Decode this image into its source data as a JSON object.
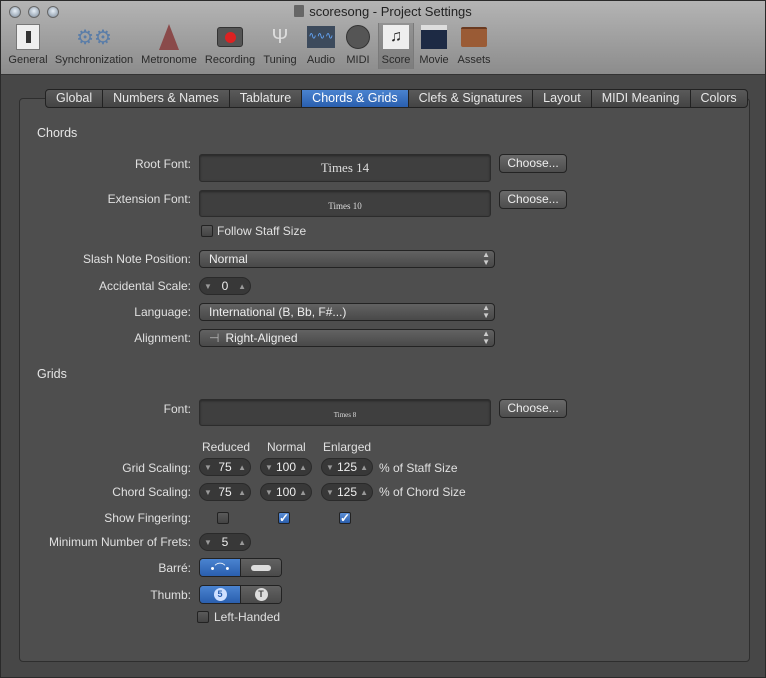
{
  "window": {
    "title": "scoresong - Project Settings"
  },
  "toolbar": [
    {
      "label": "General",
      "icon": "switch-icon"
    },
    {
      "label": "Synchronization",
      "icon": "gears-icon"
    },
    {
      "label": "Metronome",
      "icon": "metronome-icon"
    },
    {
      "label": "Recording",
      "icon": "record-icon"
    },
    {
      "label": "Tuning",
      "icon": "tuning-fork-icon"
    },
    {
      "label": "Audio",
      "icon": "waveform-icon"
    },
    {
      "label": "MIDI",
      "icon": "midi-port-icon"
    },
    {
      "label": "Score",
      "icon": "music-note-icon",
      "selected": true
    },
    {
      "label": "Movie",
      "icon": "clapperboard-icon"
    },
    {
      "label": "Assets",
      "icon": "briefcase-icon"
    }
  ],
  "tabs": [
    "Global",
    "Numbers & Names",
    "Tablature",
    "Chords & Grids",
    "Clefs & Signatures",
    "Layout",
    "MIDI Meaning",
    "Colors"
  ],
  "active_tab": "Chords & Grids",
  "chords": {
    "heading": "Chords",
    "root_font_label": "Root Font:",
    "root_font": "Times 14",
    "extension_font_label": "Extension Font:",
    "extension_font": "Times 10",
    "choose": "Choose...",
    "follow_staff_size": "Follow Staff Size",
    "follow_staff_size_checked": false,
    "slash_label": "Slash Note Position:",
    "slash_value": "Normal",
    "accidental_label": "Accidental Scale:",
    "accidental_value": "0",
    "language_label": "Language:",
    "language_value": "International (B, Bb, F#...)",
    "alignment_label": "Alignment:",
    "alignment_value": "Right-Aligned"
  },
  "grids": {
    "heading": "Grids",
    "font_label": "Font:",
    "font": "Times 8",
    "choose": "Choose...",
    "col_reduced": "Reduced",
    "col_normal": "Normal",
    "col_enlarged": "Enlarged",
    "grid_scaling_label": "Grid Scaling:",
    "grid_scaling": [
      "75",
      "100",
      "125"
    ],
    "grid_suffix": "% of Staff Size",
    "chord_scaling_label": "Chord Scaling:",
    "chord_scaling": [
      "75",
      "100",
      "125"
    ],
    "chord_suffix": "% of Chord Size",
    "fingering_label": "Show Fingering:",
    "fingering": [
      false,
      true,
      true
    ],
    "frets_label": "Minimum Number of Frets:",
    "frets": "5",
    "barre_label": "Barré:",
    "barre_selected": "arc",
    "thumb_label": "Thumb:",
    "thumb_selected": "5",
    "thumb_options": [
      "5",
      "T"
    ],
    "left_handed": "Left-Handed",
    "left_handed_checked": false
  }
}
